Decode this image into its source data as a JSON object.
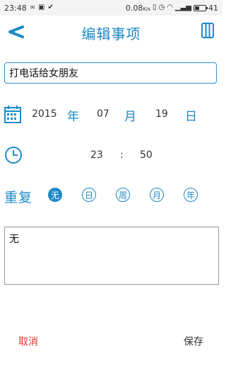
{
  "status_bar": {
    "time": "23:48",
    "data_rate": "0.08",
    "data_unit": "K/s",
    "battery": "41",
    "battery_level": 0.41,
    "left_icons": [
      "infinity-icon",
      "image-icon",
      "check-circle-icon"
    ],
    "right_icons": [
      "vibrate-icon",
      "alarm-icon",
      "wifi-icon",
      "signal-icon",
      "battery-icon"
    ]
  },
  "header": {
    "title": "编辑事项"
  },
  "title_field": {
    "value": "打电话给女朋友"
  },
  "date": {
    "year": "2015",
    "year_unit": "年",
    "month": "07",
    "month_unit": "月",
    "day": "19",
    "day_unit": "日"
  },
  "time": {
    "hour": "23",
    "separator": ":",
    "minute": "50"
  },
  "repeat": {
    "label": "重复",
    "options": [
      "无",
      "日",
      "周",
      "月",
      "年"
    ],
    "selected": "无"
  },
  "note": {
    "value": "无"
  },
  "actions": {
    "cancel": "取消",
    "save": "保存"
  },
  "colors": {
    "accent": "#1e8ac8",
    "cancel": "#d63a2b"
  }
}
